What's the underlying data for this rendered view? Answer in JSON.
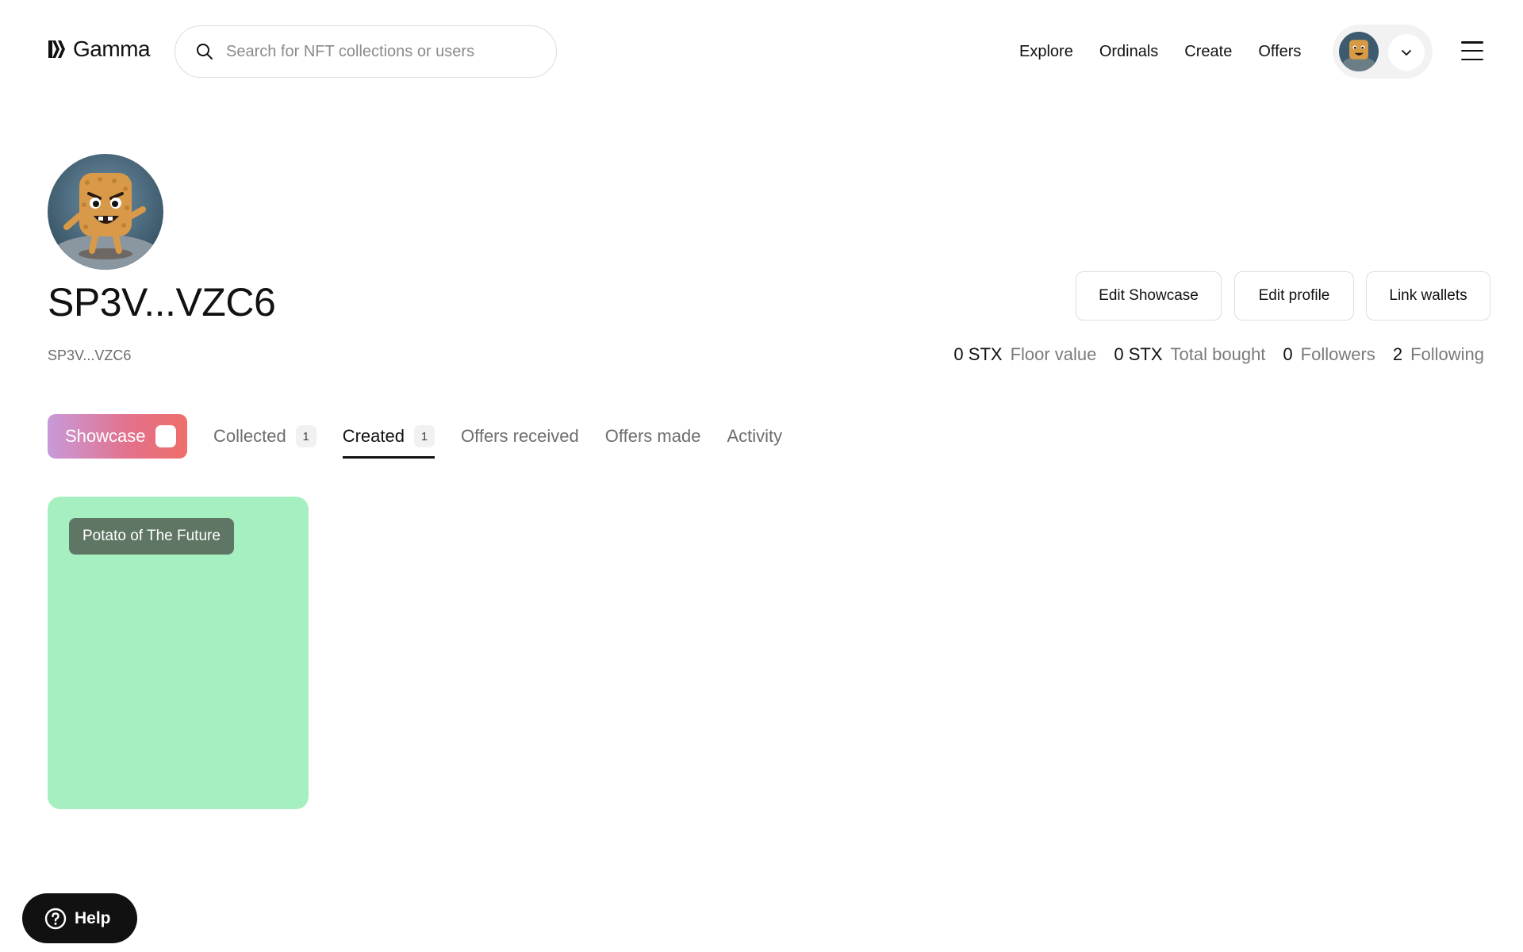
{
  "header": {
    "brand": "Gamma",
    "search_placeholder": "Search for NFT collections or users",
    "nav": [
      "Explore",
      "Ordinals",
      "Create",
      "Offers"
    ]
  },
  "profile": {
    "name": "SP3V...VZC6",
    "address": "SP3V...VZC6",
    "actions": {
      "edit_showcase": "Edit Showcase",
      "edit_profile": "Edit profile",
      "link_wallets": "Link wallets"
    },
    "stats": [
      {
        "value": "0 STX",
        "label": "Floor value"
      },
      {
        "value": "0 STX",
        "label": "Total bought"
      },
      {
        "value": "0",
        "label": "Followers"
      },
      {
        "value": "2",
        "label": "Following"
      }
    ]
  },
  "tabs": {
    "showcase": "Showcase",
    "collected": {
      "label": "Collected",
      "count": "1"
    },
    "created": {
      "label": "Created",
      "count": "1"
    },
    "offers_received": "Offers received",
    "offers_made": "Offers made",
    "activity": "Activity",
    "active": "Created"
  },
  "items": [
    {
      "title": "Potato of The Future",
      "background": "#a6efc0"
    }
  ],
  "help": {
    "label": "Help"
  },
  "colors": {
    "accent_gradient": [
      "#c89ad9",
      "#e4708a",
      "#ee6f6a"
    ],
    "card_bg": "#a6efc0",
    "chip_bg": "#5f7664"
  }
}
